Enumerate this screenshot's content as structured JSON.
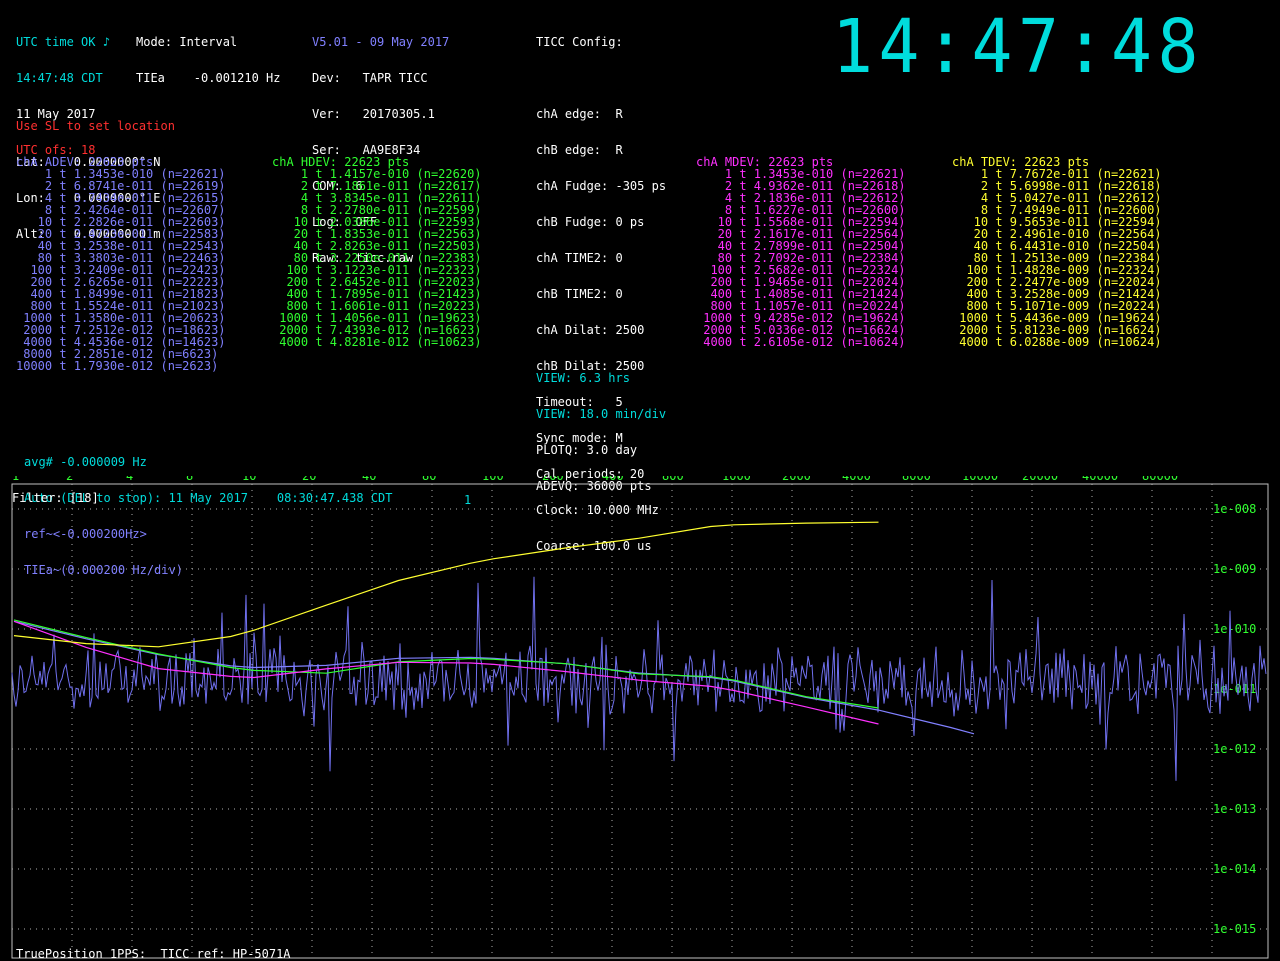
{
  "status": {
    "utc_ok": "UTC time OK ♪",
    "time_line": "14:47:48 CDT",
    "date_line": "11 May 2017",
    "utc_ofs": "UTC ofs: 18",
    "mode_line": "Mode: Interval",
    "tiea_line": "TIEa    -0.001210 Hz"
  },
  "location": {
    "warning": "Use SL to set location",
    "lat": "Lat:    0.0000000° N",
    "lon": "Lon:    0.0000000° E",
    "alt": "Alt:    0.00000000 m"
  },
  "device": {
    "version": "V5.01 - 09 May 2017",
    "lines": [
      "Dev:   TAPR TICC",
      "Ver:   20170305.1",
      "Ser:   AA9E8F34",
      "COM:  6",
      "Log:  OFF",
      "Raw:  ticc.raw"
    ]
  },
  "ticc_config": {
    "title": "TICC Config:",
    "lines": [
      "chA edge:  R",
      "chB edge:  R",
      "chA Fudge: -305 ps",
      "chB Fudge: 0 ps",
      "chA TIME2: 0",
      "chB TIME2: 0",
      "chA Dilat: 2500",
      "chB Dilat: 2500",
      "Timeout:   5",
      "Sync mode: M",
      "Cal periods: 20",
      "Clock: 10.000 MHz",
      "Coarse: 100.0 us"
    ]
  },
  "clock_big": "14:47:48",
  "tables": {
    "adev": {
      "title": "chA ADEV: 22623 pts",
      "rows": [
        "    1 t 1.3453e-010 (n=22621)",
        "    2 t 6.8741e-011 (n=22619)",
        "    4 t 3.7434e-011 (n=22615)",
        "    8 t 2.4264e-011 (n=22607)",
        "   10 t 2.2826e-011 (n=22603)",
        "   20 t 2.4723e-011 (n=22583)",
        "   40 t 3.2538e-011 (n=22543)",
        "   80 t 3.3803e-011 (n=22463)",
        "  100 t 3.2409e-011 (n=22423)",
        "  200 t 2.6265e-011 (n=22223)",
        "  400 t 1.8499e-011 (n=21823)",
        "  800 t 1.5524e-011 (n=21023)",
        " 1000 t 1.3580e-011 (n=20623)",
        " 2000 t 7.2512e-012 (n=18623)",
        " 4000 t 4.4536e-012 (n=14623)",
        " 8000 t 2.2851e-012 (n=6623)",
        "10000 t 1.7930e-012 (n=2623)"
      ]
    },
    "hdev": {
      "title": "chA HDEV: 22623 pts",
      "rows": [
        "    1 t 1.4157e-010 (n=22620)",
        "    2 t 7.1861e-011 (n=22617)",
        "    4 t 3.8345e-011 (n=22611)",
        "    8 t 2.2780e-011 (n=22599)",
        "   10 t 2.0386e-011 (n=22593)",
        "   20 t 1.8353e-011 (n=22563)",
        "   40 t 2.8263e-011 (n=22503)",
        "   80 t 3.2250e-011 (n=22383)",
        "  100 t 3.1223e-011 (n=22323)",
        "  200 t 2.6452e-011 (n=22023)",
        "  400 t 1.7895e-011 (n=21423)",
        "  800 t 1.6061e-011 (n=20223)",
        " 1000 t 1.4056e-011 (n=19623)",
        " 2000 t 7.4393e-012 (n=16623)",
        " 4000 t 4.8281e-012 (n=10623)"
      ]
    },
    "mdev": {
      "title": "chA MDEV: 22623 pts",
      "rows": [
        "    1 t 1.3453e-010 (n=22621)",
        "    2 t 4.9362e-011 (n=22618)",
        "    4 t 2.1836e-011 (n=22612)",
        "    8 t 1.6227e-011 (n=22600)",
        "   10 t 1.5568e-011 (n=22594)",
        "   20 t 2.1617e-011 (n=22564)",
        "   40 t 2.7899e-011 (n=22504)",
        "   80 t 2.7092e-011 (n=22384)",
        "  100 t 2.5682e-011 (n=22324)",
        "  200 t 1.9465e-011 (n=22024)",
        "  400 t 1.4085e-011 (n=21424)",
        "  800 t 1.1057e-011 (n=20224)",
        " 1000 t 9.4285e-012 (n=19624)",
        " 2000 t 5.0336e-012 (n=16624)",
        " 4000 t 2.6105e-012 (n=10624)"
      ]
    },
    "tdev": {
      "title": "chA TDEV: 22623 pts",
      "rows": [
        "    1 t 7.7672e-011 (n=22621)",
        "    2 t 5.6998e-011 (n=22618)",
        "    4 t 5.0427e-011 (n=22612)",
        "    8 t 7.4949e-011 (n=22600)",
        "   10 t 9.5653e-011 (n=22594)",
        "   20 t 2.4961e-010 (n=22564)",
        "   40 t 6.4431e-010 (n=22504)",
        "   80 t 1.2513e-009 (n=22384)",
        "  100 t 1.4828e-009 (n=22324)",
        "  200 t 2.2477e-009 (n=22024)",
        "  400 t 3.2528e-009 (n=21424)",
        "  800 t 5.1071e-009 (n=20224)",
        " 1000 t 5.4436e-009 (n=19624)",
        " 2000 t 5.8123e-009 (n=16624)",
        " 4000 t 6.0288e-009 (n=10624)"
      ]
    }
  },
  "view": {
    "view1": "VIEW: 6.3 hrs",
    "view2": "VIEW: 18.0 min/div",
    "plotq": "PLOTQ: 3.0 day",
    "adevq": "ADEVQ: 36000 pts"
  },
  "plot_info": {
    "avg": "avg# -0.000009 Hz",
    "auto_label": "Auto (DEL to stop):",
    "auto_date": "11 May 2017",
    "auto_time": "08:30:47.438 CDT",
    "ref": "ref~<-0.000200Hz>",
    "tiea": "TIEa~(0.000200 Hz/div)",
    "filter": "Filter: [18]",
    "cursor_mark": "1",
    "footer": "TruePosition 1PPS:  TICC ref: HP-5071A"
  },
  "chart_data": {
    "type": "line",
    "x_scale": "log",
    "x_tick_labels": [
      "1",
      "2",
      "4",
      "8",
      "10",
      "20",
      "40",
      "80",
      "100",
      "200",
      "400",
      "800",
      "1000",
      "2000",
      "4000",
      "8000",
      "10000",
      "20000",
      "40000",
      "80000"
    ],
    "y_scale": "log",
    "y_tick_labels": [
      "1e-008",
      "1e-009",
      "1e-010",
      "1e-011",
      "1e-012",
      "1e-013",
      "1e-014",
      "1e-015"
    ],
    "ylim": [
      1e-15,
      1e-08
    ],
    "grid": true,
    "colors": {
      "adev": "#8080ff",
      "hdev": "#30ff30",
      "mdev": "#ff30ff",
      "tdev": "#ffff30",
      "tie": "#7070ee",
      "axis": "#30ff30"
    },
    "series": [
      {
        "key": "adev",
        "x": [
          1,
          2,
          4,
          8,
          10,
          20,
          40,
          80,
          100,
          200,
          400,
          800,
          1000,
          2000,
          4000,
          8000,
          10000
        ],
        "y": [
          1.3453e-10,
          6.8741e-11,
          3.7434e-11,
          2.4264e-11,
          2.2826e-11,
          2.4723e-11,
          3.2538e-11,
          3.3803e-11,
          3.2409e-11,
          2.6265e-11,
          1.8499e-11,
          1.5524e-11,
          1.358e-11,
          7.2512e-12,
          4.4536e-12,
          2.2851e-12,
          1.793e-12
        ]
      },
      {
        "key": "hdev",
        "x": [
          1,
          2,
          4,
          8,
          10,
          20,
          40,
          80,
          100,
          200,
          400,
          800,
          1000,
          2000,
          4000
        ],
        "y": [
          1.4157e-10,
          7.1861e-11,
          3.8345e-11,
          2.278e-11,
          2.0386e-11,
          1.8353e-11,
          2.8263e-11,
          3.225e-11,
          3.1223e-11,
          2.6452e-11,
          1.7895e-11,
          1.6061e-11,
          1.4056e-11,
          7.4393e-12,
          4.8281e-12
        ]
      },
      {
        "key": "mdev",
        "x": [
          1,
          2,
          4,
          8,
          10,
          20,
          40,
          80,
          100,
          200,
          400,
          800,
          1000,
          2000,
          4000
        ],
        "y": [
          1.3453e-10,
          4.9362e-11,
          2.1836e-11,
          1.6227e-11,
          1.5568e-11,
          2.1617e-11,
          2.7899e-11,
          2.7092e-11,
          2.5682e-11,
          1.9465e-11,
          1.4085e-11,
          1.1057e-11,
          9.4285e-12,
          5.0336e-12,
          2.6105e-12
        ]
      },
      {
        "key": "tdev",
        "x": [
          1,
          2,
          4,
          8,
          10,
          20,
          40,
          80,
          100,
          200,
          400,
          800,
          1000,
          2000,
          4000
        ],
        "y": [
          7.7672e-11,
          5.6998e-11,
          5.0427e-11,
          7.4949e-11,
          9.5653e-11,
          2.4961e-10,
          6.4431e-10,
          1.2513e-09,
          1.4828e-09,
          2.2477e-09,
          3.2528e-09,
          5.1071e-09,
          5.4436e-09,
          5.8123e-09,
          6.0288e-09
        ]
      }
    ]
  }
}
